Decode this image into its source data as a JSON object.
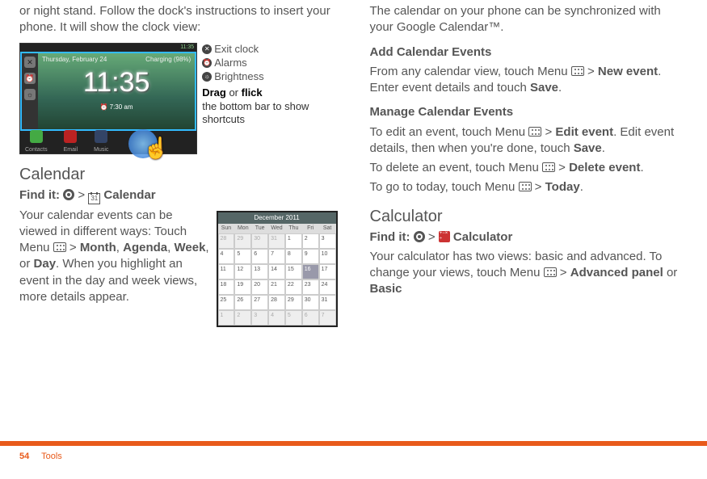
{
  "left": {
    "intro": "or night stand. Follow the dock's instructions to insert your phone. It will show the clock view:",
    "clock": {
      "status_time": "11:35",
      "date": "Thursday, February 24",
      "charging": "Charging (98%)",
      "time": "11:35",
      "alarm": "7:30 am",
      "shortcut_contacts": "Contacts",
      "shortcut_email": "Email",
      "shortcut_music": "Music"
    },
    "legend": {
      "exit": "Exit clock",
      "alarms": "Alarms",
      "brightness": "Brightness",
      "drag_bold1": "Drag",
      "drag_mid": " or ",
      "drag_bold2": "flick",
      "drag_rest": "the bottom bar to show shortcuts"
    },
    "calendar_heading": "Calendar",
    "findit": "Find it: ",
    "findit_gt": " > ",
    "calendar_label": " Calendar",
    "cal_icon_day": "31",
    "para1a": "Your calendar events can be viewed in different ways: Touch Menu ",
    "para1b": " > ",
    "month": "Month",
    "comma1": ", ",
    "agenda": "Agenda",
    "comma2": ", ",
    "week": "Week",
    "comma3": ", or ",
    "day": "Day",
    "para1c": ". When you highlight an event in the day and week views, more details appear.",
    "calshot": {
      "month_label": "December 2011",
      "dow": [
        "Sun",
        "Mon",
        "Tue",
        "Wed",
        "Thu",
        "Fri",
        "Sat"
      ],
      "cells": [
        {
          "n": "28",
          "dim": true
        },
        {
          "n": "29",
          "dim": true
        },
        {
          "n": "30",
          "dim": true
        },
        {
          "n": "31",
          "dim": true
        },
        {
          "n": "1"
        },
        {
          "n": "2"
        },
        {
          "n": "3"
        },
        {
          "n": "4"
        },
        {
          "n": "5"
        },
        {
          "n": "6"
        },
        {
          "n": "7"
        },
        {
          "n": "8"
        },
        {
          "n": "9"
        },
        {
          "n": "10"
        },
        {
          "n": "11"
        },
        {
          "n": "12"
        },
        {
          "n": "13"
        },
        {
          "n": "14"
        },
        {
          "n": "15"
        },
        {
          "n": "16",
          "hl": true
        },
        {
          "n": "17"
        },
        {
          "n": "18"
        },
        {
          "n": "19"
        },
        {
          "n": "20"
        },
        {
          "n": "21"
        },
        {
          "n": "22"
        },
        {
          "n": "23"
        },
        {
          "n": "24"
        },
        {
          "n": "25"
        },
        {
          "n": "26"
        },
        {
          "n": "27"
        },
        {
          "n": "28"
        },
        {
          "n": "29"
        },
        {
          "n": "30"
        },
        {
          "n": "31"
        },
        {
          "n": "1",
          "dim": true
        },
        {
          "n": "2",
          "dim": true
        },
        {
          "n": "3",
          "dim": true
        },
        {
          "n": "4",
          "dim": true
        },
        {
          "n": "5",
          "dim": true
        },
        {
          "n": "6",
          "dim": true
        },
        {
          "n": "7",
          "dim": true
        }
      ]
    }
  },
  "right": {
    "sync": "The calendar on your phone can be synchronized with your Google Calendar™.",
    "h_add": "Add Calendar Events",
    "add1": "From any calendar view, touch Menu ",
    "add_gt": " > ",
    "new_event": "New event",
    "add2": ". Enter event details and touch ",
    "save": "Save",
    "period": ".",
    "h_manage": "Manage Calendar Events",
    "edit1": "To edit an event, touch Menu ",
    "edit_event": "Edit event",
    "edit2": ". Edit event details, then when you're done, touch ",
    "del1": "To delete an event, touch Menu ",
    "delete_event": "Delete event",
    "today1": "To go to today, touch Menu ",
    "today": "Today",
    "h_calc": "Calculator",
    "calc_label": " Calculator",
    "calc1": "Your calculator has two views: basic and advanced. To change your views, touch Menu ",
    "adv_panel": "Advanced panel",
    "or": " or ",
    "basic": "Basic"
  },
  "footer": {
    "page": "54",
    "section": "Tools"
  }
}
